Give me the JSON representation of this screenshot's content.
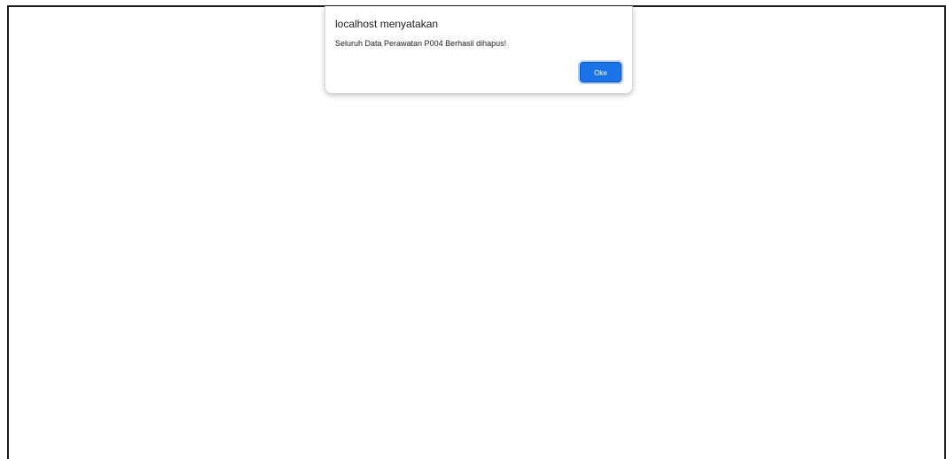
{
  "dialog": {
    "title": "localhost menyatakan",
    "message": "Seluruh Data Perawatan P004 Berhasil dihapus!",
    "ok_label": "Oke"
  },
  "colors": {
    "accent": "#1a73e8",
    "page_background": "#ffffff"
  }
}
